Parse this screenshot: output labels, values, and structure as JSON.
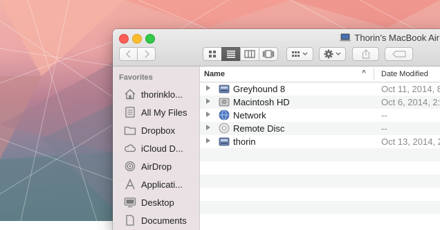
{
  "window": {
    "title": "Thorin’s MacBook Air",
    "title_icon": "laptop-icon"
  },
  "toolbar": {
    "back_icon": "chevron-left-icon",
    "forward_icon": "chevron-right-icon",
    "view_modes": [
      {
        "name": "icon-view",
        "icon": "grid-icon",
        "active": false
      },
      {
        "name": "list-view",
        "icon": "list-icon",
        "active": true
      },
      {
        "name": "column-view",
        "icon": "columns-icon",
        "active": false
      },
      {
        "name": "coverflow-view",
        "icon": "coverflow-icon",
        "active": false
      }
    ],
    "arrange_icon": "arrange-grid-icon",
    "action_icon": "gear-icon",
    "share_icon": "share-icon",
    "tag_icon": "tag-icon"
  },
  "sidebar": {
    "header": "Favorites",
    "items": [
      {
        "label": "thorinklo...",
        "icon": "home-icon"
      },
      {
        "label": "All My Files",
        "icon": "all-files-icon"
      },
      {
        "label": "Dropbox",
        "icon": "folder-icon"
      },
      {
        "label": "iCloud D...",
        "icon": "cloud-icon"
      },
      {
        "label": "AirDrop",
        "icon": "airdrop-icon"
      },
      {
        "label": "Applicati...",
        "icon": "applications-icon"
      },
      {
        "label": "Desktop",
        "icon": "desktop-icon"
      },
      {
        "label": "Documents",
        "icon": "documents-icon"
      }
    ]
  },
  "list": {
    "columns": {
      "name": "Name",
      "date": "Date Modified",
      "sort_indicator": "^"
    },
    "rows": [
      {
        "name": "Greyhound 8",
        "date": "Oct 11, 2014, 8",
        "icon": "drive-icon"
      },
      {
        "name": "Macintosh HD",
        "date": "Oct 6, 2014, 2:",
        "icon": "hard-disk-icon"
      },
      {
        "name": "Network",
        "date": "--",
        "icon": "network-globe-icon"
      },
      {
        "name": "Remote Disc",
        "date": "--",
        "icon": "disc-icon"
      },
      {
        "name": "thorin",
        "date": "Oct 13, 2014, 2",
        "icon": "drive-icon"
      }
    ]
  },
  "colors": {
    "close": "#fc5f57",
    "minimize": "#fdbc2e",
    "maximize": "#34c84a"
  }
}
